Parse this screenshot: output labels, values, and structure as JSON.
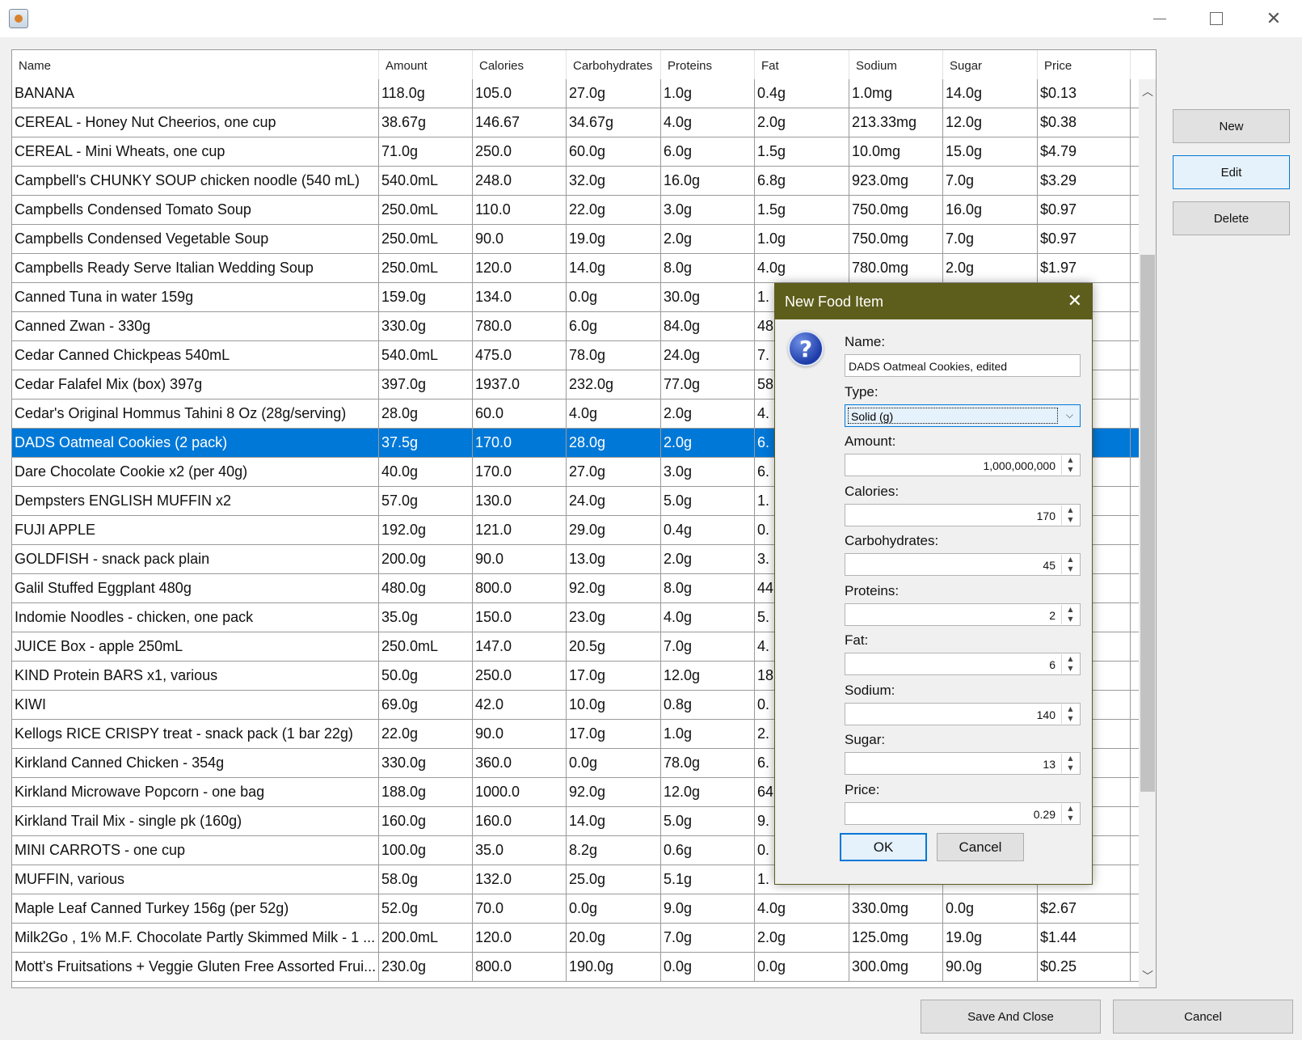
{
  "window": {
    "title": ""
  },
  "table": {
    "columns": [
      "Name",
      "Amount",
      "Calories",
      "Carbohydrates",
      "Proteins",
      "Fat",
      "Sodium",
      "Sugar",
      "Price"
    ],
    "selected_row": 12,
    "rows": [
      [
        "BANANA",
        "118.0g",
        "105.0",
        "27.0g",
        "1.0g",
        "0.4g",
        "1.0mg",
        "14.0g",
        "$0.13"
      ],
      [
        "CEREAL - Honey Nut Cheerios, one cup",
        "38.67g",
        "146.67",
        "34.67g",
        "4.0g",
        "2.0g",
        "213.33mg",
        "12.0g",
        "$0.38"
      ],
      [
        "CEREAL - Mini Wheats, one cup",
        "71.0g",
        "250.0",
        "60.0g",
        "6.0g",
        "1.5g",
        "10.0mg",
        "15.0g",
        "$4.79"
      ],
      [
        "Campbell's CHUNKY SOUP chicken noodle (540 mL)",
        "540.0mL",
        "248.0",
        "32.0g",
        "16.0g",
        "6.8g",
        "923.0mg",
        "7.0g",
        "$3.29"
      ],
      [
        "Campbells Condensed Tomato Soup",
        "250.0mL",
        "110.0",
        "22.0g",
        "3.0g",
        "1.5g",
        "750.0mg",
        "16.0g",
        "$0.97"
      ],
      [
        "Campbells Condensed Vegetable Soup",
        "250.0mL",
        "90.0",
        "19.0g",
        "2.0g",
        "1.0g",
        "750.0mg",
        "7.0g",
        "$0.97"
      ],
      [
        "Campbells Ready Serve Italian Wedding Soup",
        "250.0mL",
        "120.0",
        "14.0g",
        "8.0g",
        "4.0g",
        "780.0mg",
        "2.0g",
        "$1.97"
      ],
      [
        "Canned Tuna in water 159g",
        "159.0g",
        "134.0",
        "0.0g",
        "30.0g",
        "1.",
        "",
        "",
        ""
      ],
      [
        "Canned Zwan - 330g",
        "330.0g",
        "780.0",
        "6.0g",
        "84.0g",
        "48",
        "",
        "",
        ""
      ],
      [
        "Cedar Canned Chickpeas 540mL",
        "540.0mL",
        "475.0",
        "78.0g",
        "24.0g",
        "7.",
        "",
        "",
        ""
      ],
      [
        "Cedar Falafel Mix (box) 397g",
        "397.0g",
        "1937.0",
        "232.0g",
        "77.0g",
        "58",
        "",
        "",
        ""
      ],
      [
        "Cedar's Original Hommus Tahini 8 Oz (28g/serving)",
        "28.0g",
        "60.0",
        "4.0g",
        "2.0g",
        "4.",
        "",
        "",
        ""
      ],
      [
        "DADS Oatmeal Cookies (2 pack)",
        "37.5g",
        "170.0",
        "28.0g",
        "2.0g",
        "6.",
        "",
        "",
        ""
      ],
      [
        "Dare Chocolate Cookie x2 (per 40g)",
        "40.0g",
        "170.0",
        "27.0g",
        "3.0g",
        "6.",
        "",
        "",
        ""
      ],
      [
        "Dempsters ENGLISH MUFFIN x2",
        "57.0g",
        "130.0",
        "24.0g",
        "5.0g",
        "1.",
        "",
        "",
        ""
      ],
      [
        "FUJI APPLE",
        "192.0g",
        "121.0",
        "29.0g",
        "0.4g",
        "0.",
        "",
        "",
        ""
      ],
      [
        "GOLDFISH - snack pack plain",
        "200.0g",
        "90.0",
        "13.0g",
        "2.0g",
        "3.",
        "",
        "",
        ""
      ],
      [
        "Galil Stuffed Eggplant 480g",
        "480.0g",
        "800.0",
        "92.0g",
        "8.0g",
        "44",
        "",
        "",
        ""
      ],
      [
        "Indomie Noodles - chicken, one pack",
        "35.0g",
        "150.0",
        "23.0g",
        "4.0g",
        "5.",
        "",
        "",
        ""
      ],
      [
        "JUICE Box - apple 250mL",
        "250.0mL",
        "147.0",
        "20.5g",
        "7.0g",
        "4.",
        "",
        "",
        ""
      ],
      [
        "KIND Protein BARS x1, various",
        "50.0g",
        "250.0",
        "17.0g",
        "12.0g",
        "18",
        "",
        "",
        ""
      ],
      [
        "KIWI",
        "69.0g",
        "42.0",
        "10.0g",
        "0.8g",
        "0.",
        "",
        "",
        ""
      ],
      [
        "Kellogs RICE CRISPY treat - snack pack (1 bar 22g)",
        "22.0g",
        "90.0",
        "17.0g",
        "1.0g",
        "2.",
        "",
        "",
        ""
      ],
      [
        "Kirkland Canned Chicken - 354g",
        "330.0g",
        "360.0",
        "0.0g",
        "78.0g",
        "6.",
        "",
        "",
        ""
      ],
      [
        "Kirkland Microwave Popcorn - one bag",
        "188.0g",
        "1000.0",
        "92.0g",
        "12.0g",
        "64",
        "",
        "",
        ""
      ],
      [
        "Kirkland Trail Mix - single pk (160g)",
        "160.0g",
        "160.0",
        "14.0g",
        "5.0g",
        "9.",
        "",
        "",
        ""
      ],
      [
        "MINI CARROTS - one cup",
        "100.0g",
        "35.0",
        "8.2g",
        "0.6g",
        "0.",
        "",
        "",
        ""
      ],
      [
        "MUFFIN, various",
        "58.0g",
        "132.0",
        "25.0g",
        "5.1g",
        "1.",
        "",
        "",
        ""
      ],
      [
        "Maple Leaf Canned Turkey 156g (per 52g)",
        "52.0g",
        "70.0",
        "0.0g",
        "9.0g",
        "4.0g",
        "330.0mg",
        "0.0g",
        "$2.67"
      ],
      [
        "Milk2Go , 1% M.F. Chocolate Partly Skimmed Milk - 1 ...",
        "200.0mL",
        "120.0",
        "20.0g",
        "7.0g",
        "2.0g",
        "125.0mg",
        "19.0g",
        "$1.44"
      ],
      [
        "Mott's Fruitsations + Veggie Gluten Free Assorted Frui...",
        "230.0g",
        "800.0",
        "190.0g",
        "0.0g",
        "0.0g",
        "300.0mg",
        "90.0g",
        "$0.25"
      ]
    ]
  },
  "side_buttons": {
    "new": "New",
    "edit": "Edit",
    "delete": "Delete"
  },
  "bottom_buttons": {
    "save": "Save And Close",
    "cancel": "Cancel"
  },
  "dialog": {
    "title": "New Food Item",
    "icon": "question-icon",
    "name_label": "Name:",
    "name_value": "DADS Oatmeal Cookies, edited",
    "type_label": "Type:",
    "type_value": "Solid (g)",
    "fields": [
      {
        "label": "Amount:",
        "value": "1,000,000,000"
      },
      {
        "label": "Calories:",
        "value": "170"
      },
      {
        "label": "Carbohydrates:",
        "value": "45"
      },
      {
        "label": "Proteins:",
        "value": "2"
      },
      {
        "label": "Fat:",
        "value": "6"
      },
      {
        "label": "Sodium:",
        "value": "140"
      },
      {
        "label": "Sugar:",
        "value": "13"
      },
      {
        "label": "Price:",
        "value": "0.29"
      }
    ],
    "ok": "OK",
    "cancel": "Cancel"
  },
  "colors": {
    "selection": "#0078d7",
    "dialog_title_bg": "#5e5e1c",
    "focus_border": "#0078d7"
  }
}
